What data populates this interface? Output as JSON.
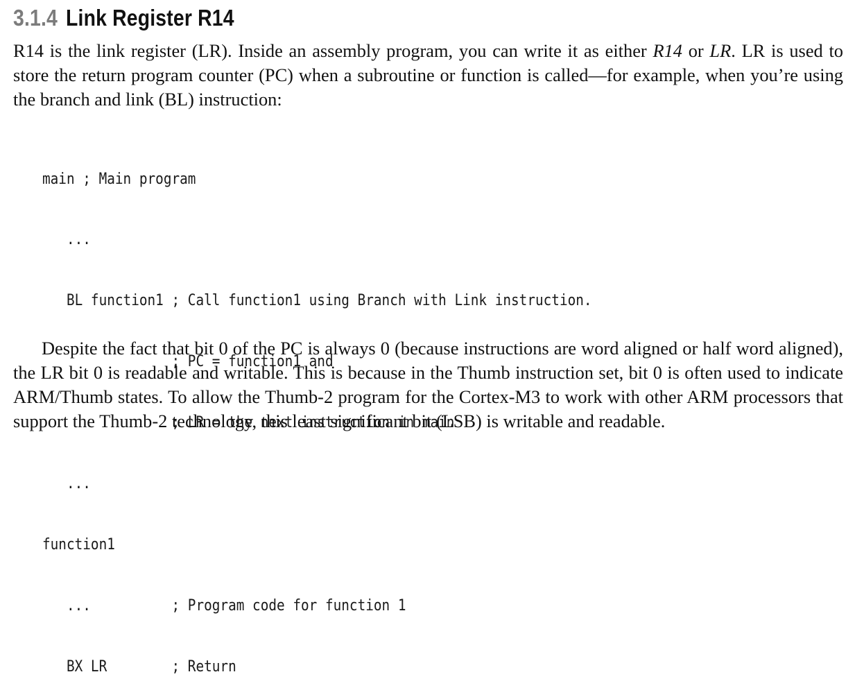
{
  "section": {
    "number": "3.1.4",
    "title": "Link Register R14"
  },
  "paragraph1": {
    "t1": "R14 is the link register (LR). Inside an assembly program, you can write it as either ",
    "r14": "R14",
    "t2": " or ",
    "lr": "LR",
    "t3": ". LR is used to store the return program counter (PC) when a subroutine or function is called—for example, when you’re using the branch and link (BL) instruction:"
  },
  "code_lines": [
    "main ; Main program",
    "   ...",
    "   BL function1 ; Call function1 using Branch with Link instruction.",
    "                ; PC = function1 and",
    "                ; LR = the next instruction in main",
    "   ...",
    "function1",
    "   ...          ; Program code for function 1",
    "   BX LR        ; Return"
  ],
  "paragraph2": "Despite the fact that bit 0 of the PC is always 0 (because instructions are word aligned or half word aligned), the LR bit 0 is readable and writable. This is because in the Thumb instruction set, bit 0 is often used to indicate ARM/Thumb states. To allow the Thumb-2 program for the Cortex-M3 to work with other ARM processors that support the Thumb-2 technology, this least significant bit (LSB) is writable and readable."
}
